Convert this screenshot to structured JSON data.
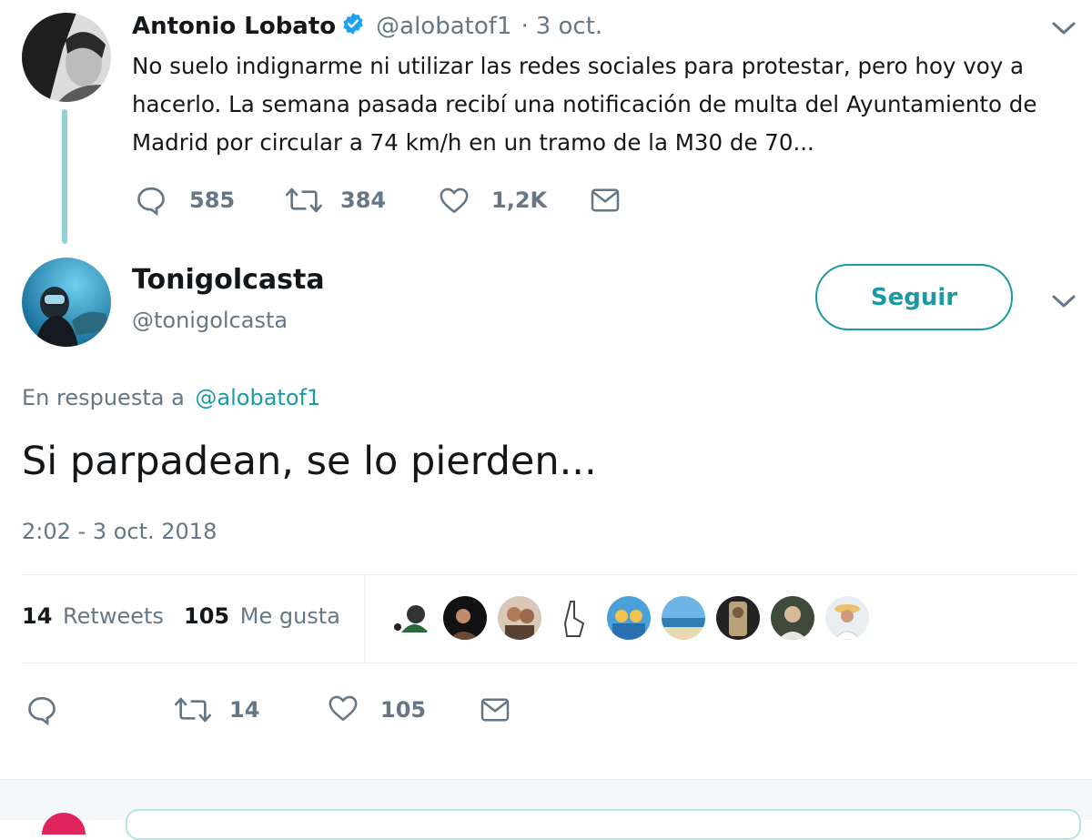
{
  "parent_tweet": {
    "name": "Antonio Lobato",
    "handle": "@alobatof1",
    "separator": "·",
    "date": "3 oct.",
    "text": "No suelo indignarme ni utilizar las redes sociales para protestar, pero hoy voy a hacerlo. La semana pasada recibí una notificación de multa del Ayuntamiento de Madrid por circular a 74 km/h en un tramo de la M30 de 70...",
    "actions": {
      "replies": "585",
      "retweets": "384",
      "likes": "1,2K"
    },
    "verified": true
  },
  "reply_tweet": {
    "name": "Tonigolcasta",
    "handle": "@tonigolcasta",
    "follow_label": "Seguir",
    "reply_prefix": "En respuesta a",
    "reply_to": "@alobatof1",
    "text": "Si parpadean, se lo pierden...",
    "timestamp": "2:02 - 3 oct. 2018",
    "stats": {
      "retweets_count": "14",
      "retweets_label": "Retweets",
      "likes_count": "105",
      "likes_label": "Me gusta"
    },
    "actions": {
      "retweets": "14",
      "likes": "105"
    }
  },
  "colors": {
    "accent": "#1b9aa4",
    "thread_line": "#8fd3d7",
    "muted": "#657786"
  },
  "liker_avatars": [
    "liker-1",
    "liker-2",
    "liker-3",
    "liker-4",
    "liker-5",
    "liker-6",
    "liker-7",
    "liker-8",
    "liker-9"
  ]
}
